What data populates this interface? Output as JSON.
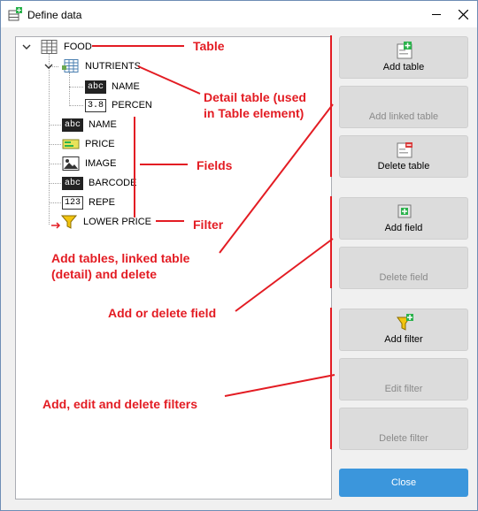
{
  "window": {
    "title": "Define data"
  },
  "tree": {
    "root": {
      "label": "FOOD"
    },
    "detail": {
      "label": "NUTRIENTS"
    },
    "detail_fields": [
      {
        "type_label": "abc",
        "label": "NAME"
      },
      {
        "type_label": "3.8",
        "label": "PERCEN"
      }
    ],
    "fields": [
      {
        "type_label": "abc",
        "label": "NAME"
      },
      {
        "type_label": "",
        "label": "PRICE"
      },
      {
        "type_label": "",
        "label": "IMAGE"
      },
      {
        "type_label": "abc",
        "label": "BARCODE"
      },
      {
        "type_label": "123",
        "label": "REPE"
      }
    ],
    "filter": {
      "label": "LOWER PRICE"
    }
  },
  "annotations": {
    "table": "Table",
    "detail_line1": "Detail table (used",
    "detail_line2": "in Table element)",
    "fields": "Fields",
    "filter": "Filter",
    "add_tables_line1": "Add tables, linked table",
    "add_tables_line2": "(detail) and delete",
    "add_field": "Add or delete field",
    "add_filters": "Add, edit and delete filters"
  },
  "buttons": {
    "add_table": "Add table",
    "add_linked_table": "Add linked table",
    "delete_table": "Delete table",
    "add_field": "Add field",
    "delete_field": "Delete field",
    "add_filter": "Add filter",
    "edit_filter": "Edit filter",
    "delete_filter": "Delete filter",
    "close": "Close"
  },
  "colors": {
    "annotation": "#e31c23",
    "primary_button": "#3b96dc",
    "icon_green": "#2bb24c",
    "icon_red": "#d93a3a",
    "filter_yellow": "#f2c40f"
  }
}
